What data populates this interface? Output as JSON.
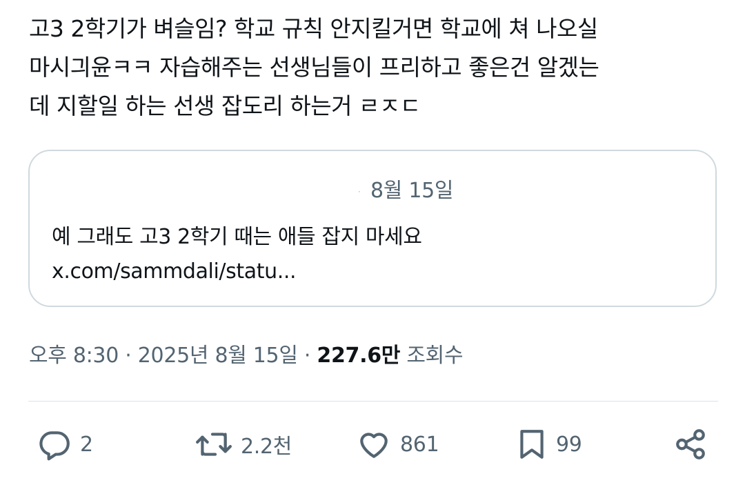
{
  "tweet": {
    "text": "고3 2학기가 벼슬임? 학교 규칙 안지킬거면 학교에 쳐 나오실\n마시긔윤ㅋㅋ 자습해주는 선생님들이 프리하고 좋은건 알겠는\n데 지할일 하는 선생 잡도리 하는거 ㄹㅈㄷ"
  },
  "quote": {
    "date": "8월 15일",
    "text_line1": "예 그래도 고3 2학기 때는 애들 잡지 마세요",
    "text_line2": "x.com/sammdali/statu..."
  },
  "meta": {
    "time": "오후 8:30",
    "separator": "·",
    "date": "2025년 8월 15일",
    "views_count": "227.6만",
    "views_label": "조회수"
  },
  "actions": {
    "reply_count": "2",
    "retweet_count": "2.2천",
    "like_count": "861",
    "bookmark_count": "99"
  },
  "icons": {
    "reply": "reply-icon",
    "retweet": "retweet-icon",
    "like": "heart-icon",
    "bookmark": "bookmark-icon",
    "share": "share-icon"
  },
  "colors": {
    "text_primary": "#0f1419",
    "text_secondary": "#536471",
    "border": "#cfd9de"
  }
}
